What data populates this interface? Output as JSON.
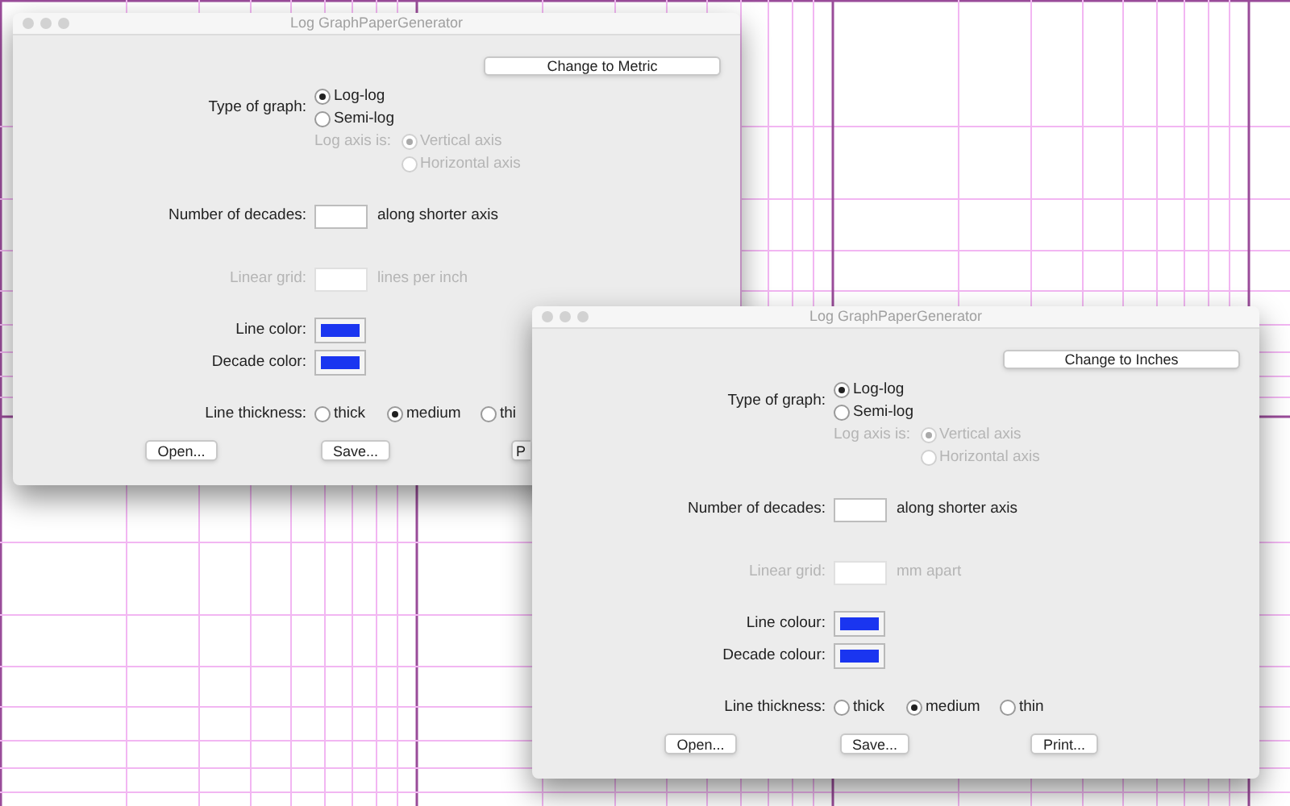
{
  "windows": [
    {
      "title": "Log GraphPaperGenerator",
      "unit_button": "Change to Metric",
      "graph_type": {
        "label": "Type of graph:",
        "options": [
          {
            "label": "Log-log",
            "selected": true
          },
          {
            "label": "Semi-log",
            "selected": false
          }
        ]
      },
      "log_axis": {
        "label": "Log axis is:",
        "disabled": true,
        "options": [
          {
            "label": "Vertical axis",
            "selected": true
          },
          {
            "label": "Horizontal axis",
            "selected": false
          }
        ]
      },
      "decades": {
        "label": "Number of decades:",
        "suffix": "along shorter axis",
        "disabled": false
      },
      "linear_grid": {
        "label": "Linear grid:",
        "suffix": "lines per inch",
        "disabled": true
      },
      "colors": [
        {
          "label": "Line color:",
          "color": "#1a35f0"
        },
        {
          "label": "Decade color:",
          "color": "#1a35f0"
        }
      ],
      "thickness": {
        "label": "Line thickness:",
        "options": [
          {
            "label": "thick",
            "selected": false
          },
          {
            "label": "medium",
            "selected": true
          },
          {
            "label": "thi",
            "selected": false
          }
        ]
      },
      "buttons": [
        "Open...",
        "Save...",
        "P"
      ]
    },
    {
      "title": "Log GraphPaperGenerator",
      "unit_button": "Change to Inches",
      "graph_type": {
        "label": "Type of graph:",
        "options": [
          {
            "label": "Log-log",
            "selected": true
          },
          {
            "label": "Semi-log",
            "selected": false
          }
        ]
      },
      "log_axis": {
        "label": "Log axis is:",
        "disabled": true,
        "options": [
          {
            "label": "Vertical axis",
            "selected": true
          },
          {
            "label": "Horizontal axis",
            "selected": false
          }
        ]
      },
      "decades": {
        "label": "Number of decades:",
        "suffix": "along shorter axis",
        "disabled": false
      },
      "linear_grid": {
        "label": "Linear grid:",
        "suffix": "mm apart",
        "disabled": true
      },
      "colors": [
        {
          "label": "Line colour:",
          "color": "#1a35f0"
        },
        {
          "label": "Decade colour:",
          "color": "#1a35f0"
        }
      ],
      "thickness": {
        "label": "Line thickness:",
        "options": [
          {
            "label": "thick",
            "selected": false
          },
          {
            "label": "medium",
            "selected": true
          },
          {
            "label": "thin",
            "selected": false
          }
        ]
      },
      "buttons": [
        "Open...",
        "Save...",
        "Print..."
      ]
    }
  ]
}
